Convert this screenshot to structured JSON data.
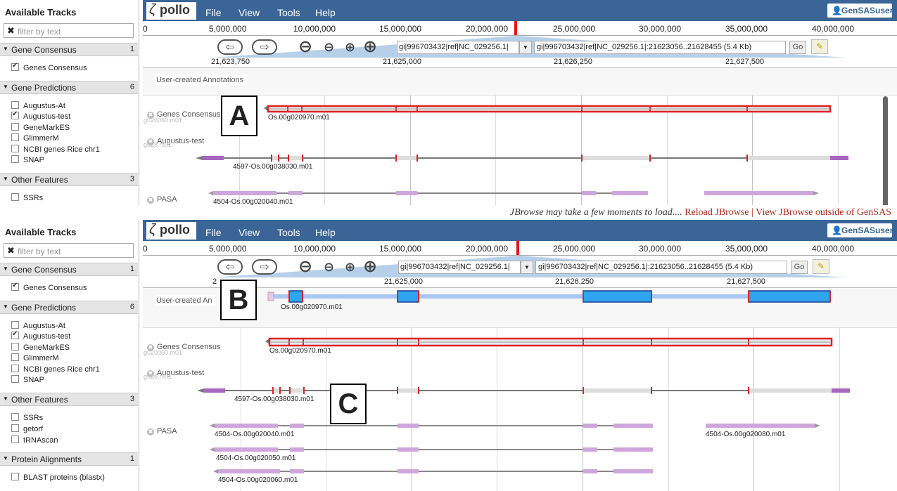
{
  "sidebar": {
    "title": "Available Tracks",
    "filter_placeholder": "filter by text",
    "categories": [
      {
        "name": "Gene Consensus",
        "count": "1"
      },
      {
        "name": "Gene Predictions",
        "count": "6"
      },
      {
        "name": "Other Features",
        "count": "3"
      },
      {
        "name": "Protein Alignments",
        "count": "1"
      }
    ],
    "tracks": {
      "genes_consensus": "Genes Consensus",
      "augustus_at": "Augustus-At",
      "augustus_test": "Augustus-test",
      "genemarkes": "GeneMarkES",
      "glimmerm": "GlimmerM",
      "ncbi": "NCBI genes Rice chr1",
      "snap": "SNAP",
      "ssrs": "SSRs",
      "getorf": "getorf",
      "trnascan": "tRNAscan",
      "blast": "BLAST proteins (blastx)"
    }
  },
  "header": {
    "logo_g": "ζ",
    "logo_text": "pollo",
    "menu": [
      "File",
      "View",
      "Tools",
      "Help"
    ],
    "user": "GenSASuser",
    "user_icon": "user-icon"
  },
  "overview_ticks": [
    "0",
    "5,000,000",
    "10,000,000",
    "15,000,000",
    "20,000,000",
    "25,000,000",
    "30,000,000",
    "35,000,000",
    "40,000,000"
  ],
  "nav": {
    "ref_seq": "gi|996703432|ref|NC_029256.1|",
    "location": "gi|996703432|ref|NC_029256.1|:21623056..21628455 (5.4 Kb)",
    "go": "Go",
    "back_icon": "back-arrow-icon",
    "forward_icon": "forward-arrow-icon",
    "highlight_icon": "highlighter-icon"
  },
  "detail_ticks": [
    "21,623,750",
    "21,625,000",
    "21,626,250",
    "21,627,500"
  ],
  "detail_tick_short": "2",
  "tracks": {
    "user_created": "User-created Annotations",
    "user_created_short": "User-created An",
    "genes_consensus": "Genes Consensus",
    "augustus_test": "Augustus-test",
    "pasa": "PASA"
  },
  "features": {
    "consensus": "Os.00g020970.m01",
    "augustus": "4597-Os.00g038030.m01",
    "pasa1": "4504-Os.00g020040.m01",
    "pasa2": "4504-Os.00g020050.m01",
    "pasa3": "4504-Os.00g020060.m01",
    "pasa4": "4504-Os.00g020080.m01",
    "faint_top": "g020060.m01",
    "faint_bottom": "g028.m01"
  },
  "letters": {
    "a": "A",
    "b": "B",
    "c": "C"
  },
  "separator": {
    "message": "JBrowse may take a few moments to load.... ",
    "reload": "Reload JBrowse",
    "divider": " | ",
    "outside": "View JBrowse outside of GenSAS"
  }
}
